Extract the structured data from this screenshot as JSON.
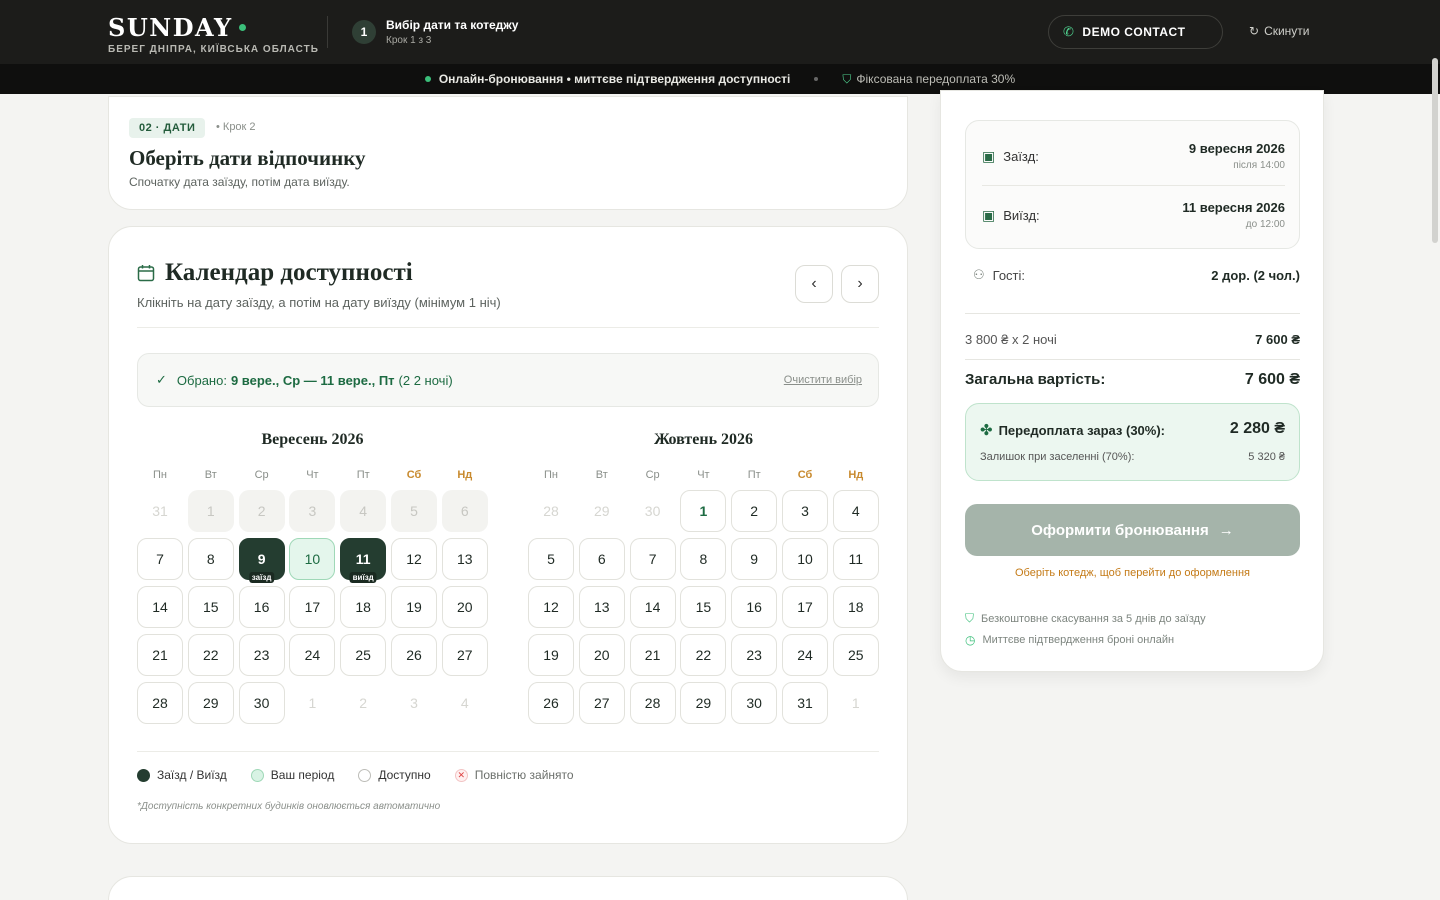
{
  "header": {
    "brand": "SUNDAY",
    "brand_sub": "БЕРЕГ ДНІПРА, КИЇВСЬКА ОБЛАСТЬ",
    "step_num": "1",
    "step_title": "Вибір дати та котеджу",
    "step_sub": "Крок 1 з 3",
    "demo_label": "DEMO CONTACT",
    "reset_label": "Скинути"
  },
  "infobar": {
    "left_bold": "Онлайн-бронювання • миттєве підтвердження доступності",
    "right": "Фіксована передоплата 30%"
  },
  "step_card": {
    "pill": "02 · ДАТИ",
    "pill_step": "• Крок 2",
    "title": "Оберіть дати відпочинку",
    "subtitle": "Спочатку дата заїзду, потім дата виїзду."
  },
  "calendar": {
    "title": "Календар доступності",
    "subtitle": "Клікніть на дату заїзду, а потім на дату виїзду (мінімум 1 ніч)",
    "selected_label": "Обрано:",
    "selected_dates": "9 вере., Ср — 11 вере., Пт",
    "selected_nights": "(2 2 ночі)",
    "clear_label": "Очистити вибір",
    "weekdays": [
      "Пн",
      "Вт",
      "Ср",
      "Чт",
      "Пт",
      "Сб",
      "Нд"
    ],
    "months": [
      {
        "title": "Вересень 2026",
        "days": [
          {
            "n": "31",
            "s": "out"
          },
          {
            "n": "1",
            "s": "past"
          },
          {
            "n": "2",
            "s": "past"
          },
          {
            "n": "3",
            "s": "past"
          },
          {
            "n": "4",
            "s": "past"
          },
          {
            "n": "5",
            "s": "past"
          },
          {
            "n": "6",
            "s": "past"
          },
          {
            "n": "7",
            "s": ""
          },
          {
            "n": "8",
            "s": ""
          },
          {
            "n": "9",
            "s": "sel",
            "tag": "заїзд"
          },
          {
            "n": "10",
            "s": "range"
          },
          {
            "n": "11",
            "s": "sel",
            "tag": "виїзд"
          },
          {
            "n": "12",
            "s": ""
          },
          {
            "n": "13",
            "s": ""
          },
          {
            "n": "14",
            "s": ""
          },
          {
            "n": "15",
            "s": ""
          },
          {
            "n": "16",
            "s": ""
          },
          {
            "n": "17",
            "s": ""
          },
          {
            "n": "18",
            "s": ""
          },
          {
            "n": "19",
            "s": ""
          },
          {
            "n": "20",
            "s": ""
          },
          {
            "n": "21",
            "s": ""
          },
          {
            "n": "22",
            "s": ""
          },
          {
            "n": "23",
            "s": ""
          },
          {
            "n": "24",
            "s": ""
          },
          {
            "n": "25",
            "s": ""
          },
          {
            "n": "26",
            "s": ""
          },
          {
            "n": "27",
            "s": ""
          },
          {
            "n": "28",
            "s": ""
          },
          {
            "n": "29",
            "s": ""
          },
          {
            "n": "30",
            "s": ""
          },
          {
            "n": "1",
            "s": "out"
          },
          {
            "n": "2",
            "s": "out"
          },
          {
            "n": "3",
            "s": "out"
          },
          {
            "n": "4",
            "s": "out"
          }
        ]
      },
      {
        "title": "Жовтень 2026",
        "days": [
          {
            "n": "28",
            "s": "out"
          },
          {
            "n": "29",
            "s": "out"
          },
          {
            "n": "30",
            "s": "out"
          },
          {
            "n": "1",
            "s": "first"
          },
          {
            "n": "2",
            "s": ""
          },
          {
            "n": "3",
            "s": ""
          },
          {
            "n": "4",
            "s": ""
          },
          {
            "n": "5",
            "s": ""
          },
          {
            "n": "6",
            "s": ""
          },
          {
            "n": "7",
            "s": ""
          },
          {
            "n": "8",
            "s": ""
          },
          {
            "n": "9",
            "s": ""
          },
          {
            "n": "10",
            "s": ""
          },
          {
            "n": "11",
            "s": ""
          },
          {
            "n": "12",
            "s": ""
          },
          {
            "n": "13",
            "s": ""
          },
          {
            "n": "14",
            "s": ""
          },
          {
            "n": "15",
            "s": ""
          },
          {
            "n": "16",
            "s": ""
          },
          {
            "n": "17",
            "s": ""
          },
          {
            "n": "18",
            "s": ""
          },
          {
            "n": "19",
            "s": ""
          },
          {
            "n": "20",
            "s": ""
          },
          {
            "n": "21",
            "s": ""
          },
          {
            "n": "22",
            "s": ""
          },
          {
            "n": "23",
            "s": ""
          },
          {
            "n": "24",
            "s": ""
          },
          {
            "n": "25",
            "s": ""
          },
          {
            "n": "26",
            "s": ""
          },
          {
            "n": "27",
            "s": ""
          },
          {
            "n": "28",
            "s": ""
          },
          {
            "n": "29",
            "s": ""
          },
          {
            "n": "30",
            "s": ""
          },
          {
            "n": "31",
            "s": ""
          },
          {
            "n": "1",
            "s": "out"
          }
        ]
      }
    ],
    "legend": {
      "checkin": "Заїзд / Виїзд",
      "period": "Ваш період",
      "available": "Доступно",
      "taken": "Повністю зайнято"
    },
    "note": "*Доступність конкретних будинків оновлюється автоматично"
  },
  "summary": {
    "checkin_label": "Заїзд:",
    "checkin_date": "9 вересня 2026",
    "checkin_time": "після 14:00",
    "checkout_label": "Виїзд:",
    "checkout_date": "11 вересня 2026",
    "checkout_time": "до 12:00",
    "guests_label": "Гості:",
    "guests_value": "2 дор. (2 чол.)",
    "price_calc": "3 800 ₴ x 2 ночі",
    "price_sum": "7 600 ₴",
    "total_label": "Загальна вартість:",
    "total_value": "7 600 ₴",
    "prepay_label": "Передоплата зараз (30%):",
    "prepay_value": "2 280 ₴",
    "remainder_label": "Залишок при заселенні (70%):",
    "remainder_value": "5 320 ₴",
    "book_label": "Оформити бронювання",
    "warning": "Оберіть котедж, щоб перейти до оформлення",
    "feature1": "Безкоштовне скасування за 5 днів до заїзду",
    "feature2": "Миттєве підтвердження броні онлайн"
  },
  "colors": {
    "accent": "#1d6b42",
    "dark_selected": "#243d30",
    "weekend": "#c88a2e",
    "warning": "#c47a16"
  },
  "icons": [
    "phone-icon",
    "reset-icon",
    "shield-icon",
    "calendar-icon",
    "check-icon",
    "users-icon",
    "sparkle-icon",
    "clock-icon",
    "chevron-left-icon",
    "chevron-right-icon",
    "arrow-right-icon"
  ]
}
